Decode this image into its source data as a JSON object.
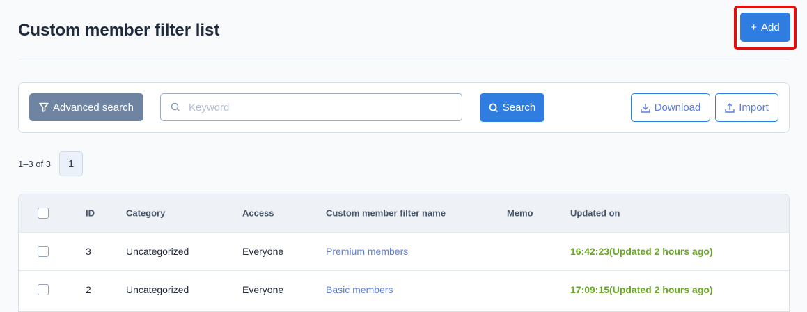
{
  "header": {
    "title": "Custom member filter list",
    "add_label": "Add"
  },
  "toolbar": {
    "advanced_search_label": "Advanced search",
    "keyword_placeholder": "Keyword",
    "search_label": "Search",
    "download_label": "Download",
    "import_label": "Import"
  },
  "pagination": {
    "summary": "1–3 of 3",
    "current_page": "1"
  },
  "table": {
    "columns": [
      "ID",
      "Category",
      "Access",
      "Custom member filter name",
      "Memo",
      "Updated on"
    ],
    "rows": [
      {
        "id": "3",
        "category": "Uncategorized",
        "access": "Everyone",
        "name": "Premium members",
        "memo": "",
        "updated": "16:42:23(Updated 2 hours ago)"
      },
      {
        "id": "2",
        "category": "Uncategorized",
        "access": "Everyone",
        "name": "Basic members",
        "memo": "",
        "updated": "17:09:15(Updated 2 hours ago)"
      }
    ]
  },
  "colors": {
    "primary": "#2f7de1",
    "highlight": "#e0100f",
    "updated": "#6aa827"
  }
}
